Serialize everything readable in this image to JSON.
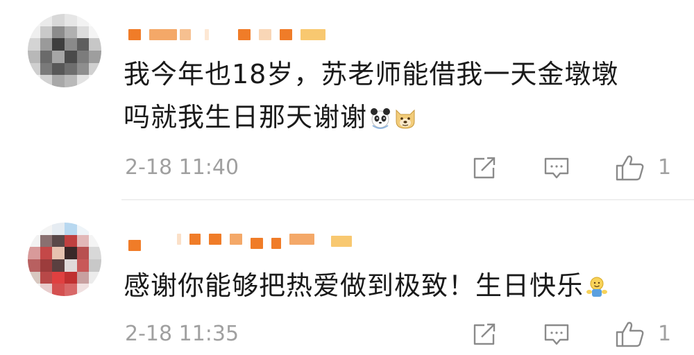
{
  "comments": [
    {
      "content_line1": "我今年也18岁，苏老师能借我一天金墩墩",
      "content_line2": "吗就我生日那天谢谢",
      "emojis": [
        "panda-emoji",
        "doge-emoji"
      ],
      "time": "2-18 11:40",
      "like_count": "1"
    },
    {
      "content_line1": "感谢你能够把热爱做到极致！生日快乐",
      "emojis": [
        "cheer-emoji"
      ],
      "time": "2-18 11:35",
      "like_count": "1"
    }
  ],
  "icons": {
    "share": "share-icon",
    "comment": "comment-icon",
    "like": "thumbs-up-icon"
  },
  "colors": {
    "timestamp": "#a0a0a0",
    "text": "#1a1a1a",
    "masked_username": "#f07c28"
  }
}
